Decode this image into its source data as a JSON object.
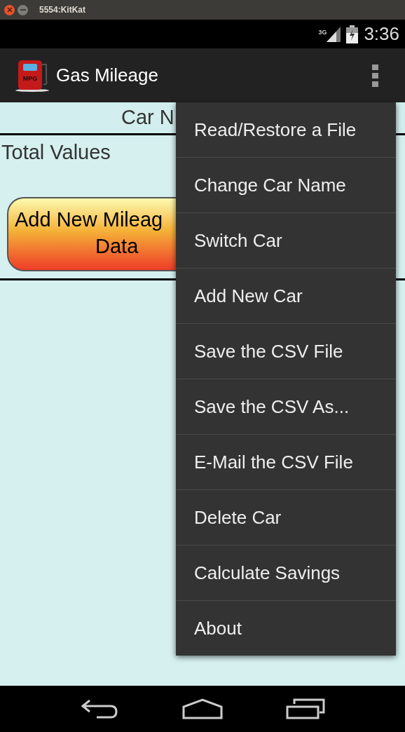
{
  "window": {
    "title": "5554:KitKat"
  },
  "status_bar": {
    "network": "3G",
    "time": "3:36"
  },
  "action_bar": {
    "title": "Gas Mileage",
    "icon_label": "MPG"
  },
  "content": {
    "car_name": "Car N",
    "total_label": "Total Values",
    "add_button": [
      "Add New Mileag",
      "Data"
    ]
  },
  "menu": {
    "items": [
      {
        "label": "Read/Restore a File"
      },
      {
        "label": "Change Car Name"
      },
      {
        "label": "Switch Car"
      },
      {
        "label": "Add New Car"
      },
      {
        "label": "Save the CSV File"
      },
      {
        "label": "Save the CSV As..."
      },
      {
        "label": "E-Mail the CSV File"
      },
      {
        "label": "Delete Car"
      },
      {
        "label": "Calculate Savings"
      },
      {
        "label": "About"
      }
    ]
  }
}
